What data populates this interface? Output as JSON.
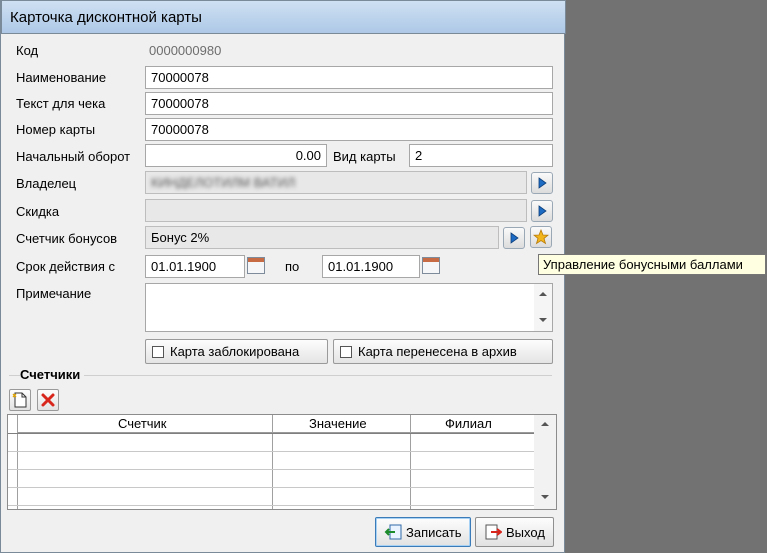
{
  "window": {
    "title": "Карточка дисконтной карты"
  },
  "fields": {
    "code_label": "Код",
    "code_value": "0000000980",
    "name_label": "Наименование",
    "name_value": "70000078",
    "receipt_label": "Текст для чека",
    "receipt_value": "70000078",
    "card_no_label": "Номер карты",
    "card_no_value": "70000078",
    "start_turnover_label": "Начальный оборот",
    "start_turnover_value": "0.00",
    "card_type_label": "Вид карты",
    "card_type_value": "2",
    "owner_label": "Владелец",
    "owner_value": "КИНДЕЛОТИЛМ ВАТИЛ",
    "discount_label": "Скидка",
    "discount_value": "",
    "bonus_label": "Счетчик бонусов",
    "bonus_value": "Бонус 2%",
    "validity_label": "Срок действия с",
    "validity_from": "01.01.1900",
    "validity_to_label": "по",
    "validity_to": "01.01.1900",
    "note_label": "Примечание",
    "note_value": ""
  },
  "tooltip": "Управление бонусными баллами",
  "checkboxes": {
    "blocked_label": "Карта заблокирована",
    "blocked_checked": false,
    "archived_label": "Карта перенесена в архив",
    "archived_checked": false
  },
  "counters": {
    "section_title": "Счетчики",
    "columns": [
      "Счетчик",
      "Значение",
      "Филиал"
    ],
    "rows": []
  },
  "footer": {
    "save_label": "Записать",
    "exit_label": "Выход"
  },
  "icons": {
    "picker": "play-arrow-icon",
    "bonus_manage": "star-icon",
    "calendar": "calendar-icon",
    "add": "new-document-icon",
    "delete": "red-x-icon",
    "save": "save-arrow-icon",
    "exit": "exit-door-icon"
  },
  "colors": {
    "accent_blue": "#1e6bc4",
    "delete_red": "#d8261c",
    "star_gold": "#f2b51c"
  }
}
